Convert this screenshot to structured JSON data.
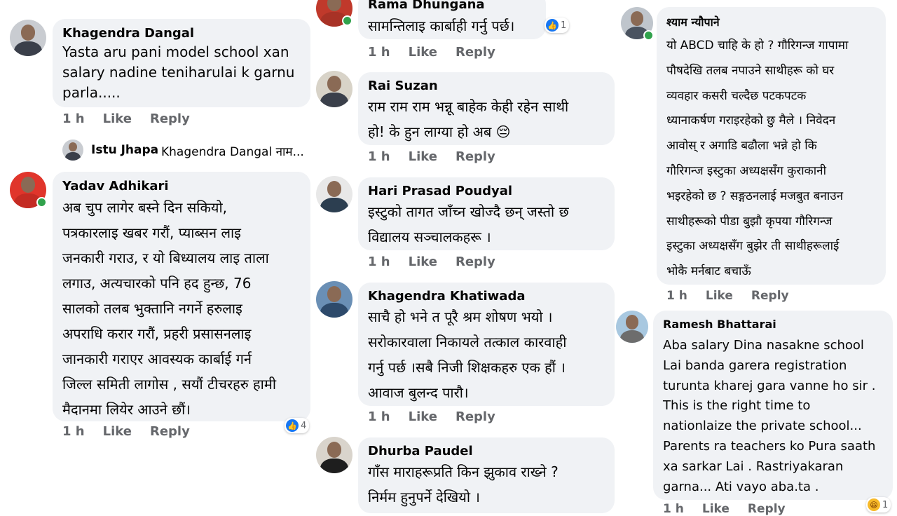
{
  "actions": {
    "time": "1 h",
    "like": "Like",
    "reply": "Reply"
  },
  "col1": {
    "c1": {
      "name": "Khagendra Dangal",
      "lines": [
        "Yasta aru pani model school xan",
        "salary nadine teniharulai k garnu",
        "parla....."
      ]
    },
    "reply_preview": {
      "name": "Istu Jhapa",
      "text": "Khagendra Dangal नाम..."
    },
    "c2": {
      "name": "Yadav Adhikari",
      "lines": [
        "अब चुप लागेर बस्ने दिन सकियो,",
        "पत्रकारलाइ खबर गरौं,  प्याब्सन लाइ",
        "जनकारी गराउ, र यो बिध्यालय लाइ ताला",
        "लगाउ, अत्यचारको पनि हद हुन्छ, 76",
        "सालको तलब भुक्तानि नगर्ने हरुलाइ",
        "अपराधि करार गरौं, प्रहरी प्रसासनलाइ",
        "जानकारी गराएर आवस्यक कार्बाई गर्न",
        "जिल्ल समिती लागोस  , सयौं टीचरहरु हामी",
        "मैदानमा लियेर आउने छौं।"
      ],
      "reaction_count": "4"
    }
  },
  "col2": {
    "c0": {
      "name": "Rama Dhungana",
      "lines": [
        "सामन्तिलाइ कार्बाही गर्नु पर्छ।"
      ],
      "reaction_count": "1"
    },
    "c1": {
      "name": "Rai Suzan",
      "lines": [
        "राम राम राम भन्नू बाहेक केही रहेन साथी",
        "हो! के हुन लाग्या हो अब 😔"
      ]
    },
    "c2": {
      "name": "Hari Prasad Poudyal",
      "lines": [
        "इस्टुको तागत जाँच्न खोज्दै छन् जस्तो छ",
        "विद्यालय सञ्चालकहरू ।"
      ]
    },
    "c3": {
      "name": "Khagendra Khatiwada",
      "lines": [
        "साचै हो भने त पूरै श्रम शोषण भयो ।",
        "सरोकारवाला निकायले तत्काल कारवाही",
        "गर्नु पर्छ ।सबै निजी शिक्षकहरु एक हौं ।",
        "आवाज बुलन्द पारौ।"
      ]
    },
    "c4": {
      "name": "Dhurba Paudel",
      "lines": [
        "गाँस माराहरूप्रति किन झुकाव राख्ने ?",
        "निर्मम हुनुपर्ने देखियो ।"
      ]
    }
  },
  "col3": {
    "c1": {
      "name": "श्याम न्यौपाने",
      "lines": [
        "यो ABCD चाहि के हो ? गौरिगन्ज गापामा",
        "पौषदेखि तलब नपाउने साथीहरू को घर",
        "व्यवहार कसरी चल्दैछ पटकपटक",
        "ध्यानाकर्षण गराइरहेको छु मैले । निवेदन",
        "आवोस् र अगाडि बढौला भन्ने हो कि",
        "गौरिगन्ज इस्टुका अध्यक्षसँग कुराकानी",
        "भइरहेको छ ? सङ्गठनलाई मजबुत बनाउन",
        "साथीहरूको पीडा बुझौ कृपया गौरिगन्ज",
        "इस्टुका अध्यक्षसँग बुझेर ती साथीहरूलाई",
        "भोकै मर्नबाट बचाऊँ"
      ]
    },
    "c2": {
      "name": "Ramesh Bhattarai",
      "lines": [
        "Aba salary Dina nasakne school",
        "Lai  banda garera registration",
        "turunta kharej gara vanne ho sir .",
        "This is the right time  to",
        "nationlaize the private school...",
        "Parents ra teachers ko Pura saath",
        "xa sarkar Lai . Rastriyakaran",
        "garna... Ati vayo aba.ta ."
      ],
      "reaction_count": "1"
    }
  }
}
